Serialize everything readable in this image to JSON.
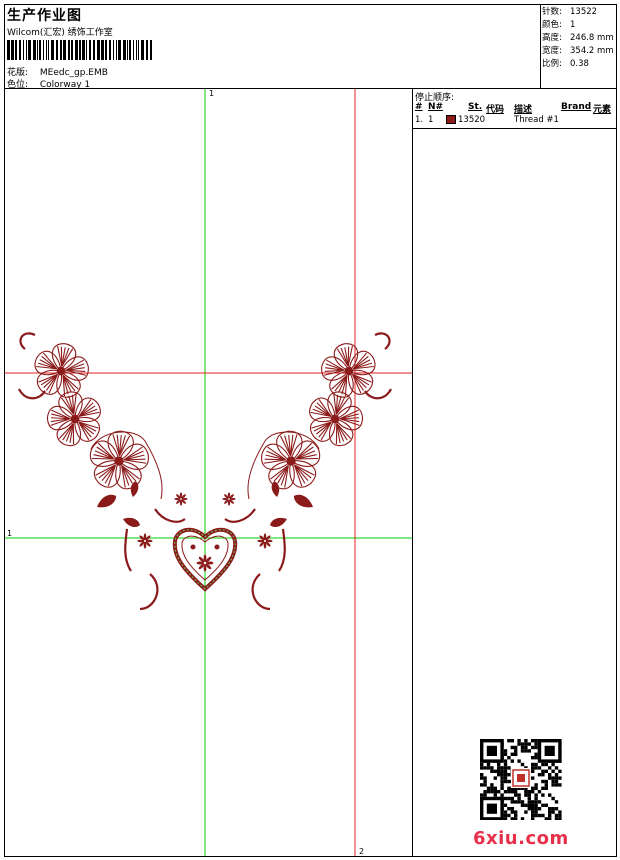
{
  "header": {
    "title": "生产作业图",
    "studio": "Wilcom(汇宏) 绣饰工作室",
    "design_label": "花版:",
    "design_value": "MEedc_gp.EMB",
    "colorway_label": "色位:",
    "colorway_value": "Colorway 1"
  },
  "stats": [
    {
      "label": "针数:",
      "value": "13522"
    },
    {
      "label": "颜色:",
      "value": "1"
    },
    {
      "label": "高度:",
      "value": "246.8 mm"
    },
    {
      "label": "宽度:",
      "value": "354.2 mm"
    },
    {
      "label": "比例:",
      "value": "0.38"
    }
  ],
  "stop_sequence": {
    "title": "停止顺序:",
    "columns": [
      "#",
      "N#",
      "St.",
      "代码",
      "描述",
      "Brand",
      "元素"
    ],
    "rows": [
      {
        "index": "1.",
        "needle": "1",
        "stitches": "13520",
        "description": "Thread #1",
        "color": "#8b1a1a"
      }
    ]
  },
  "guides": {
    "vertical_1": "1",
    "horizontal_1": "1",
    "vertical_2": "2"
  },
  "colors": {
    "design": "#8b1a1a",
    "guide_green": "#00cc00",
    "guide_red": "#e02020"
  },
  "watermark": "6xiu.com"
}
